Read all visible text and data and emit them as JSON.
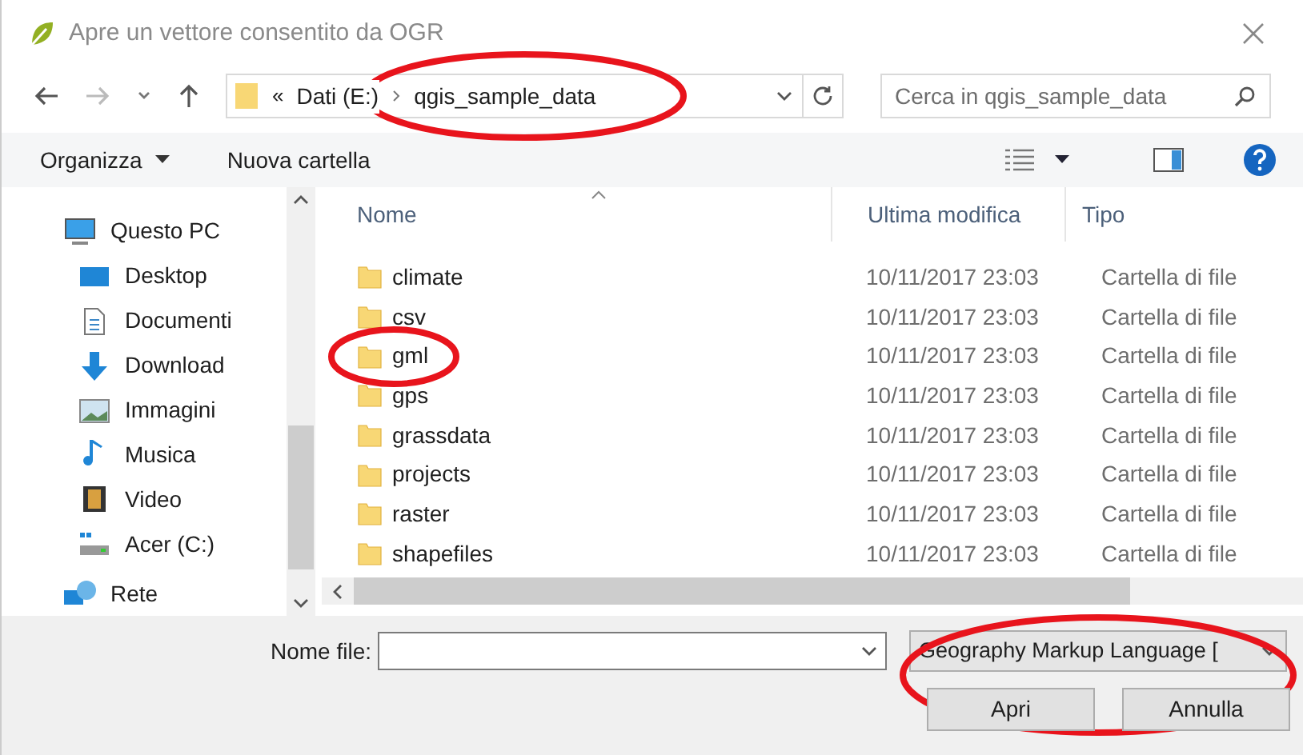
{
  "window": {
    "title": "Apre un vettore consentito da OGR"
  },
  "address": {
    "overflow": "«",
    "segments": [
      {
        "label": "Dati (E:)",
        "highlight": false
      },
      {
        "label": "qgis_sample_data",
        "highlight": true
      }
    ]
  },
  "search": {
    "placeholder": "Cerca in qgis_sample_data"
  },
  "toolbar": {
    "organize": "Organizza",
    "new_folder": "Nuova cartella"
  },
  "sidebar": {
    "items": [
      {
        "label": "Questo PC",
        "children": [
          {
            "label": "Desktop"
          },
          {
            "label": "Documenti"
          },
          {
            "label": "Download"
          },
          {
            "label": "Immagini"
          },
          {
            "label": "Musica"
          },
          {
            "label": "Video"
          },
          {
            "label": "Acer (C:)"
          }
        ]
      },
      {
        "label": "Rete"
      }
    ]
  },
  "table": {
    "columns": [
      "Nome",
      "Ultima modifica",
      "Tipo"
    ],
    "rows": [
      {
        "name": "climate",
        "modified": "10/11/2017 23:03",
        "type": "Cartella di file",
        "highlight": false
      },
      {
        "name": "csv",
        "modified": "10/11/2017 23:03",
        "type": "Cartella di file",
        "highlight": false
      },
      {
        "name": "gml",
        "modified": "10/11/2017 23:03",
        "type": "Cartella di file",
        "highlight": true
      },
      {
        "name": "gps",
        "modified": "10/11/2017 23:03",
        "type": "Cartella di file",
        "highlight": false
      },
      {
        "name": "grassdata",
        "modified": "10/11/2017 23:03",
        "type": "Cartella di file",
        "highlight": false
      },
      {
        "name": "projects",
        "modified": "10/11/2017 23:03",
        "type": "Cartella di file",
        "highlight": false
      },
      {
        "name": "raster",
        "modified": "10/11/2017 23:03",
        "type": "Cartella di file",
        "highlight": false
      },
      {
        "name": "shapefiles",
        "modified": "10/11/2017 23:03",
        "type": "Cartella di file",
        "highlight": false
      }
    ]
  },
  "footer": {
    "filename_label": "Nome file:",
    "filetype": {
      "value": "Geography Markup Language [",
      "highlight": true
    },
    "buttons": [
      "Apri",
      "Annulla"
    ]
  }
}
